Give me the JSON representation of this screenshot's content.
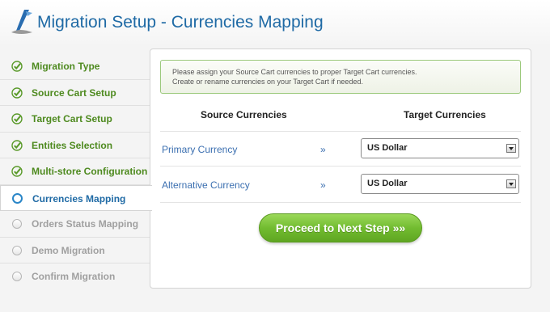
{
  "header": {
    "title": "Migration Setup - Currencies Mapping"
  },
  "sidebar": {
    "items": [
      {
        "label": "Migration Type",
        "state": "done"
      },
      {
        "label": "Source Cart Setup",
        "state": "done"
      },
      {
        "label": "Target Cart Setup",
        "state": "done"
      },
      {
        "label": "Entities Selection",
        "state": "done"
      },
      {
        "label": "Multi-store Configuration",
        "state": "done"
      },
      {
        "label": "Currencies Mapping",
        "state": "active"
      },
      {
        "label": "Orders Status Mapping",
        "state": "pending"
      },
      {
        "label": "Demo Migration",
        "state": "pending"
      },
      {
        "label": "Confirm Migration",
        "state": "pending"
      }
    ]
  },
  "main": {
    "notice_line1": "Please assign your Source Cart currencies to proper Target Cart currencies.",
    "notice_line2": "Create or rename currencies on your Target Cart if needed.",
    "source_header": "Source Currencies",
    "target_header": "Target Currencies",
    "rows": [
      {
        "source": "Primary Currency",
        "arrow": "»",
        "target": "US Dollar"
      },
      {
        "source": "Alternative Currency",
        "arrow": "»",
        "target": "US Dollar"
      }
    ],
    "proceed_label": "Proceed to Next Step »»"
  },
  "colors": {
    "accent_blue": "#1f6aa5",
    "done_green": "#4e8a1f",
    "button_green": "#72bc30"
  }
}
